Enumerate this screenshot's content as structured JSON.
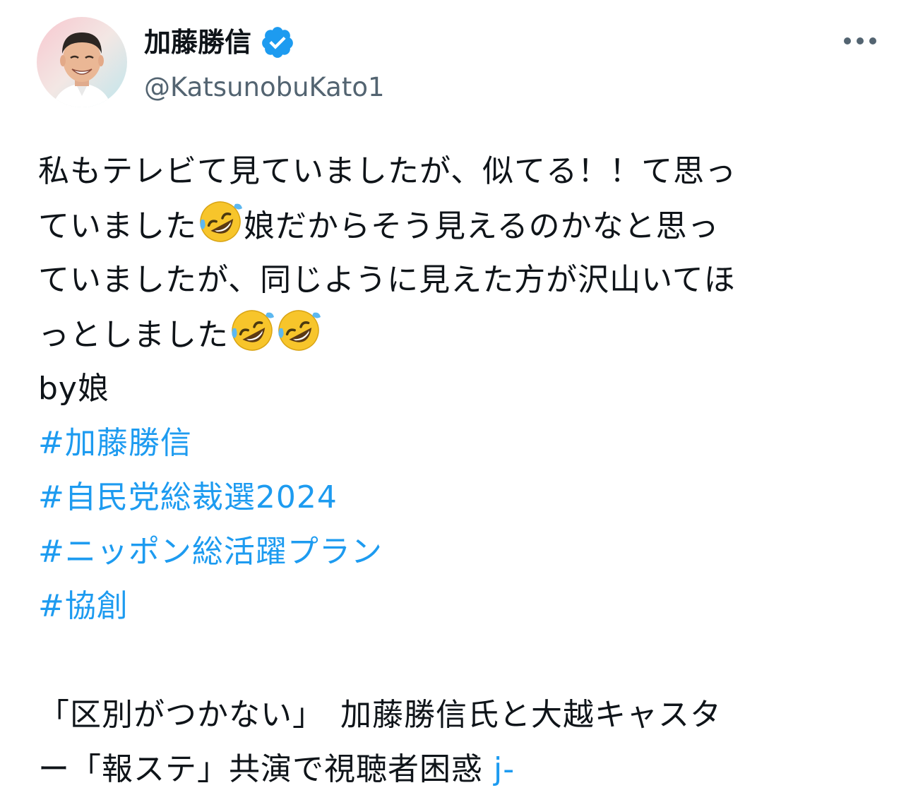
{
  "author": {
    "display_name": "加藤勝信",
    "handle": "@KatsunobuKato1",
    "verified": true
  },
  "icons": {
    "verified": "verified-badge-icon",
    "more": "more-horizontal-icon",
    "emoji": "rolling-on-the-floor-laughing-emoji"
  },
  "colors": {
    "link": "#1d9bf0",
    "verified": "#1d9bf0",
    "secondary_text": "#536471",
    "text": "#0f1419"
  },
  "body": {
    "line1": "私もテレビて見ていましたが、似てる！！て思っ",
    "line2a": "ていました",
    "line2b": "娘だからそう見えるのかなと思っ",
    "line3": "ていましたが、同じように見えた方が沢山いてほ",
    "line4": "っとしました",
    "line5": "by娘",
    "hashtags": [
      "#加藤勝信",
      "#自民党総裁選2024",
      "#ニッポン総活躍プラン",
      "#協創"
    ],
    "quote_line1": "「区別がつかない」　加藤勝信氏と大越キャスタ",
    "quote_line2": "ー「報ステ」共演で視聴者困惑 ",
    "link_text": "j-"
  }
}
